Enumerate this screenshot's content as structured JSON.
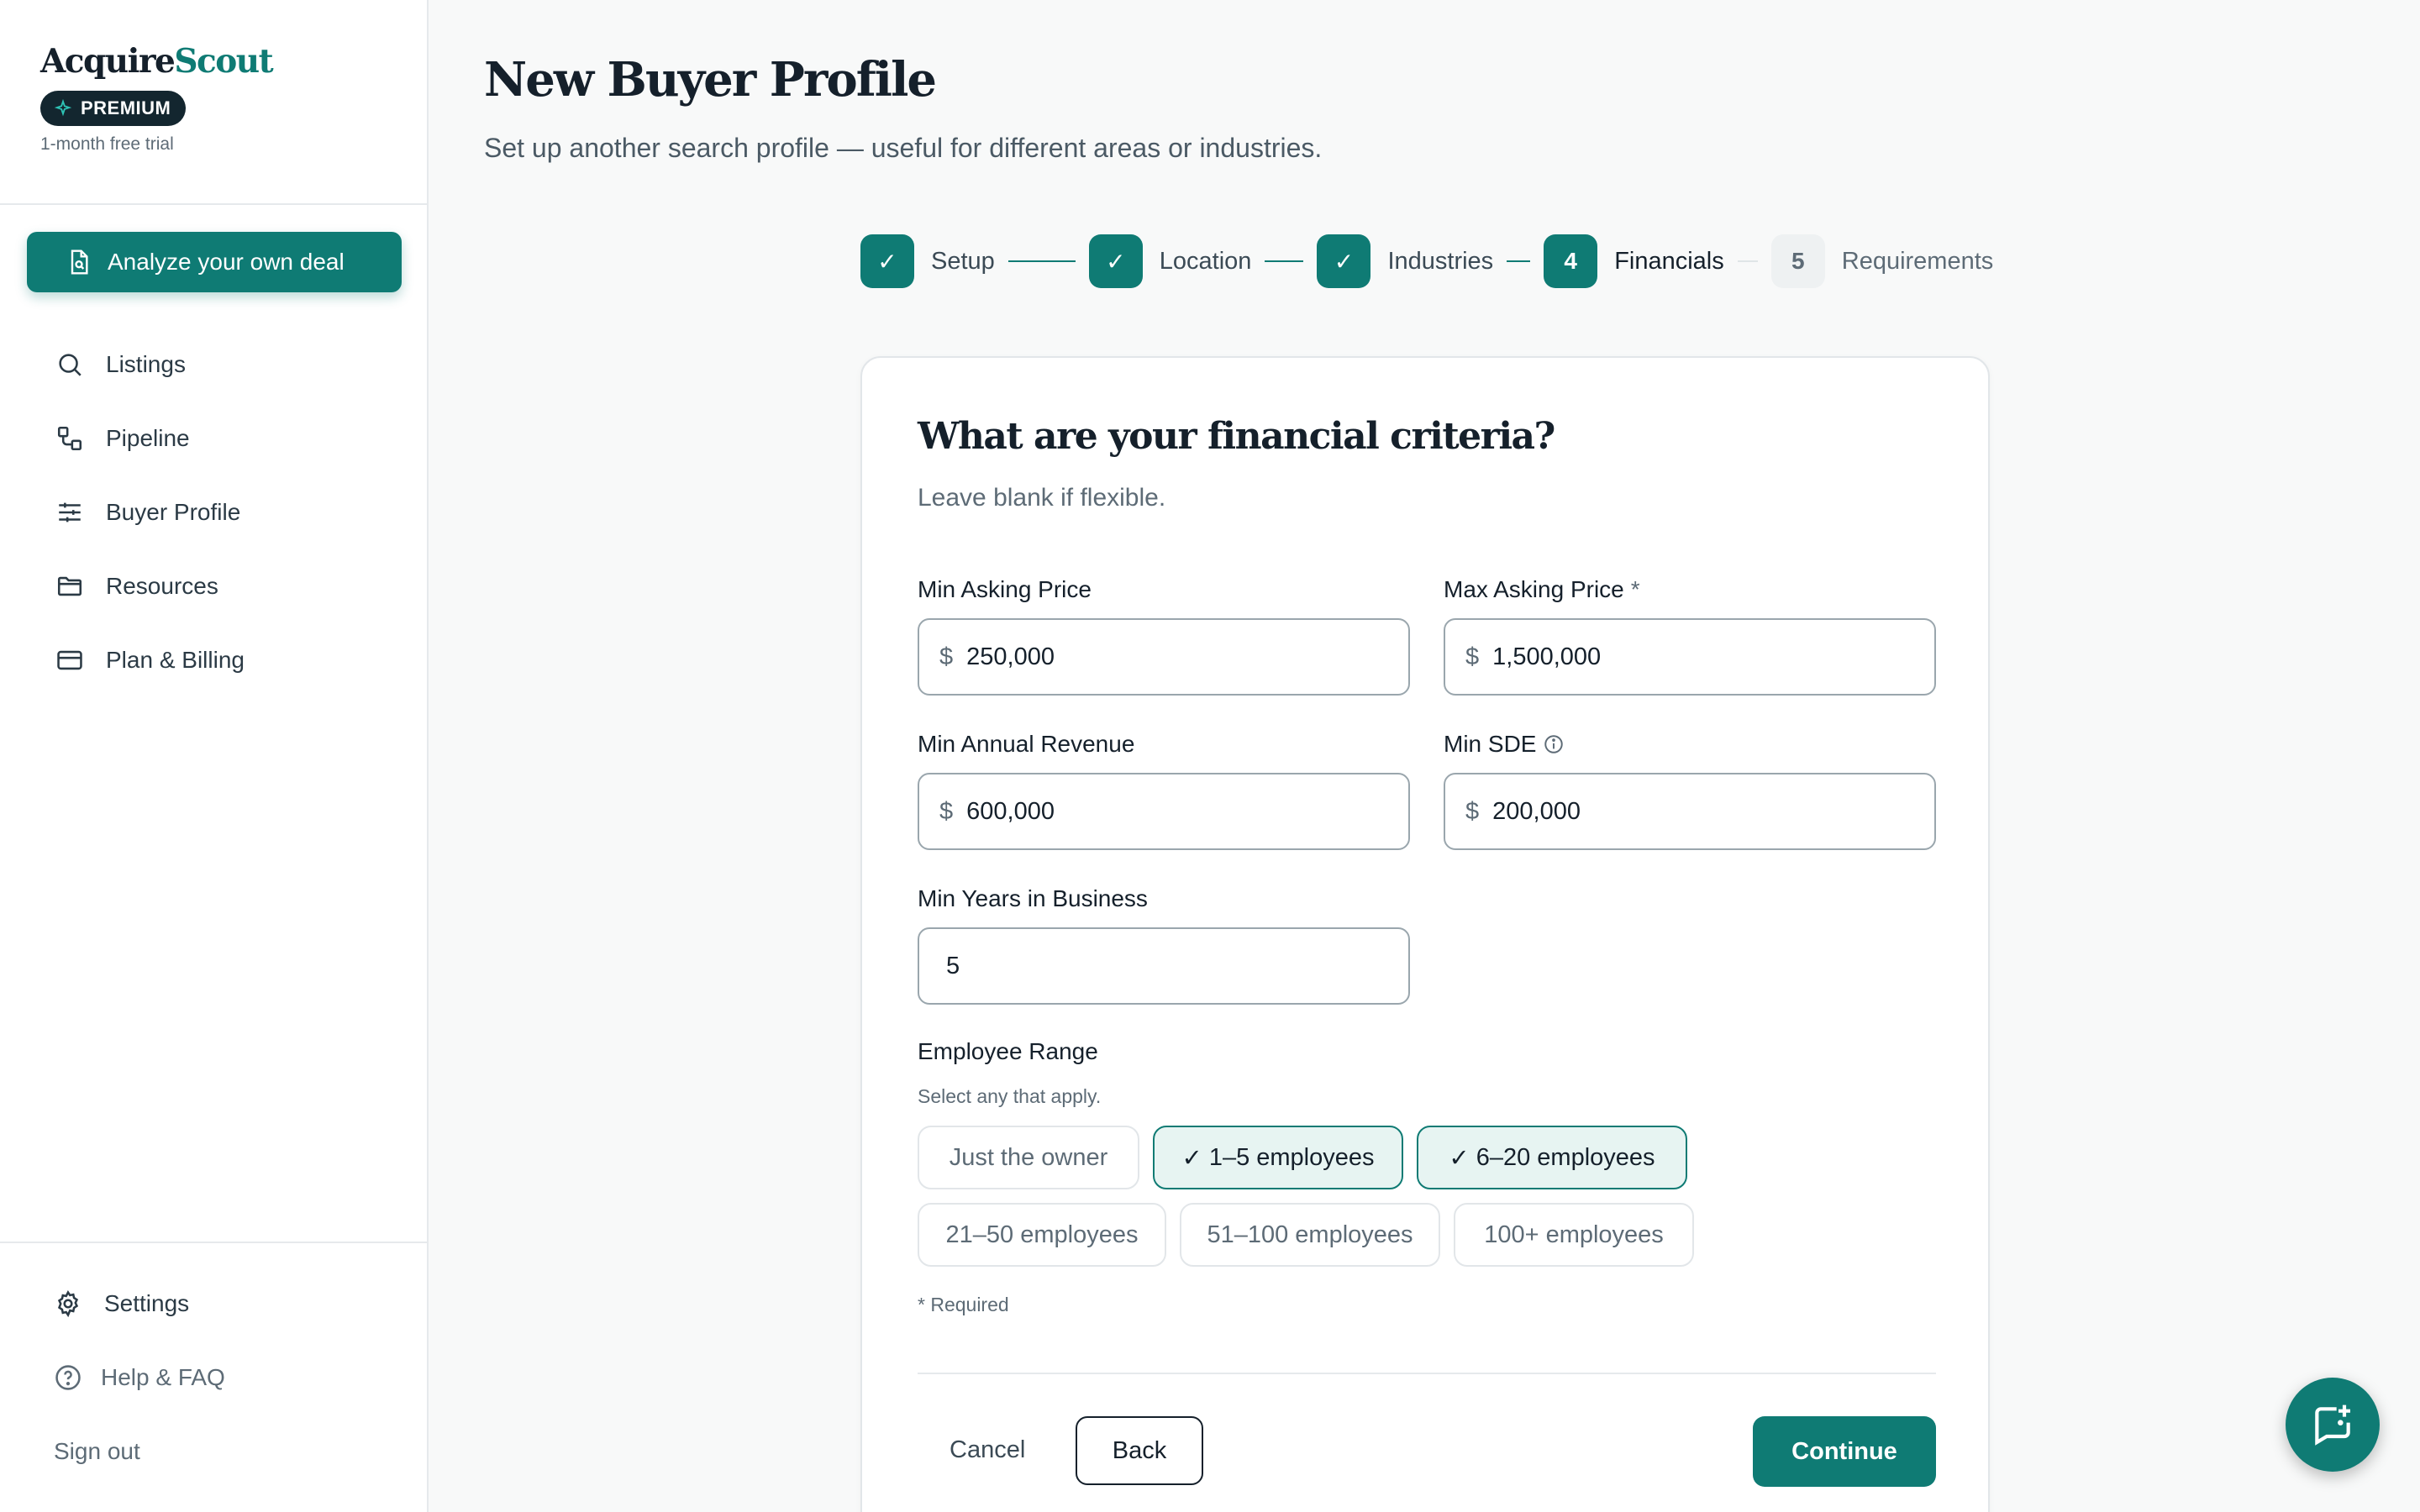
{
  "brand": {
    "logo_main": "Acquire",
    "logo_accent": "Scout",
    "badge": "PREMIUM",
    "trial": "1-month free trial"
  },
  "sidebar": {
    "analyze_label": "Analyze your own deal",
    "items": [
      {
        "label": "Listings",
        "icon": "search-icon"
      },
      {
        "label": "Pipeline",
        "icon": "pipeline-icon"
      },
      {
        "label": "Buyer Profile",
        "icon": "sliders-icon"
      },
      {
        "label": "Resources",
        "icon": "folder-icon"
      },
      {
        "label": "Plan & Billing",
        "icon": "credit-card-icon"
      }
    ],
    "bottom": {
      "settings": "Settings",
      "help": "Help & FAQ",
      "signout": "Sign out"
    }
  },
  "header": {
    "title": "New Buyer Profile",
    "subtitle": "Set up another search profile — useful for different areas or industries."
  },
  "stepper": {
    "steps": [
      {
        "label": "Setup",
        "state": "done",
        "mark": "✓"
      },
      {
        "label": "Location",
        "state": "done",
        "mark": "✓"
      },
      {
        "label": "Industries",
        "state": "done",
        "mark": "✓"
      },
      {
        "label": "Financials",
        "state": "current",
        "mark": "4"
      },
      {
        "label": "Requirements",
        "state": "todo",
        "mark": "5"
      }
    ]
  },
  "form": {
    "title": "What are your financial criteria?",
    "subtitle": "Leave blank if flexible.",
    "currency": "$",
    "min_asking": {
      "label": "Min Asking Price",
      "value": "250,000"
    },
    "max_asking": {
      "label": "Max Asking Price",
      "required_mark": "*",
      "value": "1,500,000"
    },
    "min_revenue": {
      "label": "Min Annual Revenue",
      "value": "600,000"
    },
    "min_sde": {
      "label": "Min SDE",
      "value": "200,000"
    },
    "min_years": {
      "label": "Min Years in Business",
      "value": "5"
    },
    "employee_range": {
      "label": "Employee Range",
      "help": "Select any that apply.",
      "options": [
        {
          "label": "Just the owner",
          "selected": false
        },
        {
          "label": "1–5 employees",
          "selected": true
        },
        {
          "label": "6–20 employees",
          "selected": true
        },
        {
          "label": "21–50 employees",
          "selected": false
        },
        {
          "label": "51–100 employees",
          "selected": false
        },
        {
          "label": "100+ employees",
          "selected": false
        }
      ],
      "check": "✓"
    },
    "required_note": "* Required",
    "cancel": "Cancel",
    "back": "Back",
    "continue": "Continue"
  },
  "colors": {
    "accent": "#0f7b74",
    "dark": "#13262f",
    "chip_selected_bg": "#e7f4f2"
  }
}
